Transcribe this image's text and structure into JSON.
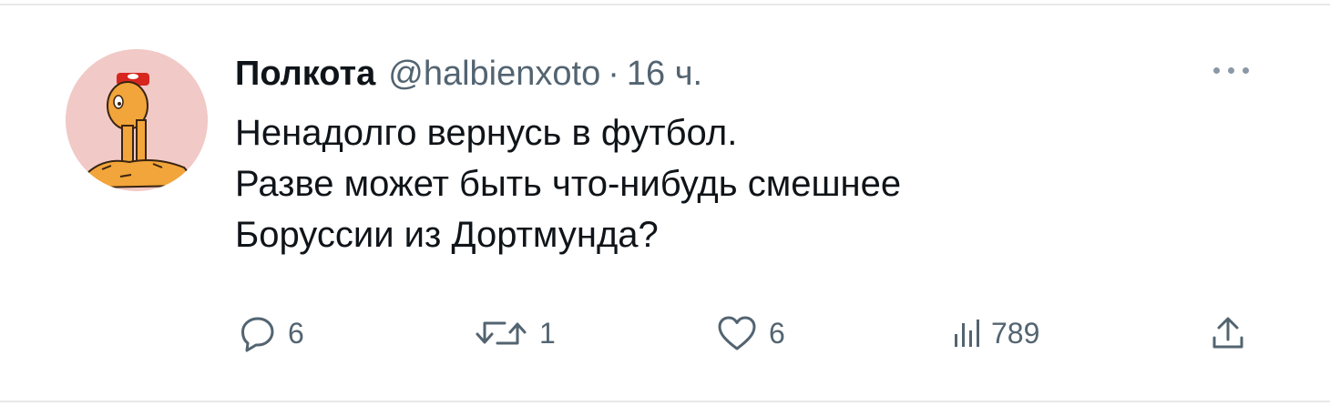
{
  "tweet": {
    "author": {
      "name": "Полкота",
      "handle": "@halbienxoto",
      "separator": "·",
      "time": "16 ч.",
      "avatar_bg": "#f1c9c6"
    },
    "text_lines": [
      "Ненадолго вернусь в футбол.",
      "Разве может быть что-нибудь смешнее",
      "Боруссии из Дортмунда?"
    ],
    "actions": {
      "reply": {
        "icon": "reply-icon",
        "count": "6"
      },
      "retweet": {
        "icon": "retweet-icon",
        "count": "1"
      },
      "like": {
        "icon": "heart-icon",
        "count": "6"
      },
      "views": {
        "icon": "views-icon",
        "count": "789"
      },
      "share": {
        "icon": "share-icon"
      }
    },
    "colors": {
      "text": "#0f1419",
      "secondary": "#536471",
      "divider": "#e6e8ea"
    }
  }
}
